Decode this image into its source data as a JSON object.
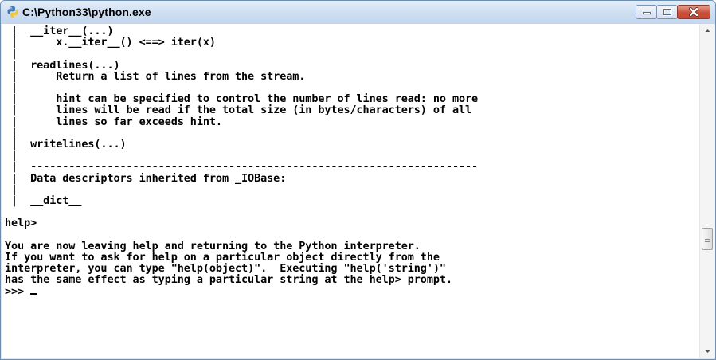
{
  "window": {
    "title": "C:\\Python33\\python.exe"
  },
  "controls": {
    "minimize": "minimize",
    "maximize": "maximize",
    "close": "close"
  },
  "console": {
    "lines": [
      " |  __iter__(...)",
      " |      x.__iter__() <==> iter(x)",
      " |",
      " |  readlines(...)",
      " |      Return a list of lines from the stream.",
      " |",
      " |      hint can be specified to control the number of lines read: no more",
      " |      lines will be read if the total size (in bytes/characters) of all",
      " |      lines so far exceeds hint.",
      " |",
      " |  writelines(...)",
      " |",
      " |  ----------------------------------------------------------------------",
      " |  Data descriptors inherited from _IOBase:",
      " |",
      " |  __dict__",
      "",
      "help>",
      "",
      "You are now leaving help and returning to the Python interpreter.",
      "If you want to ask for help on a particular object directly from the",
      "interpreter, you can type \"help(object)\".  Executing \"help('string')\"",
      "has the same effect as typing a particular string at the help> prompt.",
      ">>> "
    ]
  }
}
